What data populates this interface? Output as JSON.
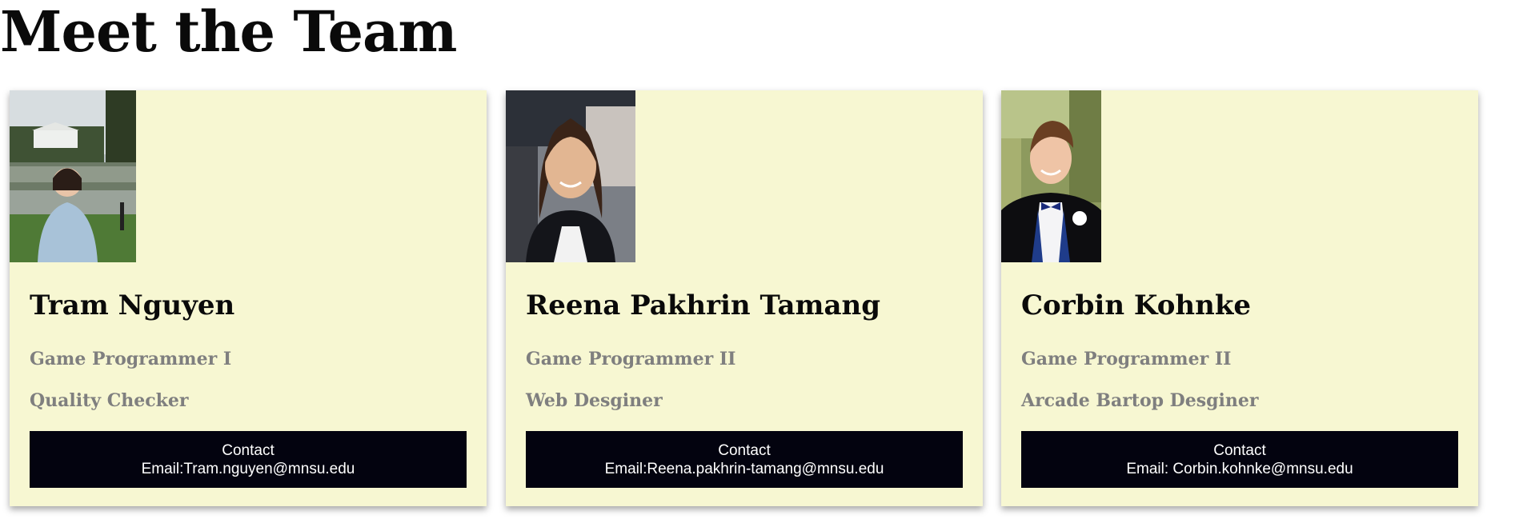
{
  "page": {
    "title": "Meet the Team"
  },
  "team": [
    {
      "name": "Tram Nguyen",
      "role_primary": "Game Programmer I",
      "role_secondary": "Quality Checker",
      "contact_label": "Contact",
      "email_text": "Email:Tram.nguyen@mnsu.edu",
      "photo_alt": "Tram Nguyen"
    },
    {
      "name": "Reena Pakhrin Tamang",
      "role_primary": "Game Programmer II",
      "role_secondary": "Web Desginer",
      "contact_label": "Contact",
      "email_text": "Email:Reena.pakhrin-tamang@mnsu.edu",
      "photo_alt": "Reena Pakhrin Tamang"
    },
    {
      "name": "Corbin Kohnke",
      "role_primary": "Game Programmer II",
      "role_secondary": "Arcade Bartop Desginer",
      "contact_label": "Contact",
      "email_text": "Email: Corbin.kohnke@mnsu.edu",
      "photo_alt": "Corbin Kohnke"
    }
  ],
  "colors": {
    "card_background": "#f7f7d2",
    "contact_button": "#03030f",
    "role_text": "#7f7f7f"
  }
}
